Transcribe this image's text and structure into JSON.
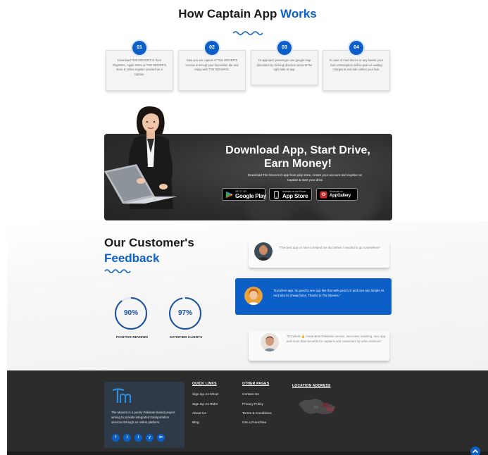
{
  "how_it_works": {
    "title_main": "How Captain App",
    "title_accent": "Works",
    "steps": [
      {
        "num": "01",
        "text": "Download THE MOVER'S D from PlayStore, Apple Store or THE MOVER'S store & online register yourself as a captain."
      },
      {
        "num": "02",
        "text": "Now you are captain of THE MOVER'S receive & accept your favorable ride and enjoy with THE MOVER'S."
      },
      {
        "num": "03",
        "text": "To approach passenger use google map directions by clicking direction arrow at the right side of app."
      },
      {
        "num": "04",
        "text": "In case of road blocks or any hassle your fuel consumption will be paid as waiting charges & end ride collect your fare."
      }
    ]
  },
  "banner": {
    "title": "Download App, Start Drive, Earn Money!",
    "subtitle": "Download The Movers D app from paly store, create your account and register as Captain & start your drive",
    "google_play": {
      "small": "GET IT ON",
      "big": "Google Play"
    },
    "app_store": {
      "small": "Available on the iPhone",
      "big": "App Store"
    },
    "app_gallery": {
      "small": "Download on",
      "big": "AppGallery"
    }
  },
  "feedback": {
    "title_main": "Our Customer's",
    "title_accent": "Feedback",
    "stats": [
      {
        "value": "90%",
        "fraction": 0.9,
        "label": "POSITIVE REVIEWS"
      },
      {
        "value": "97%",
        "fraction": 0.97,
        "label": "SATISFIED CLIENTS"
      }
    ],
    "reviews": [
      {
        "text": "\"The best app on here it helped me alot When I needed to go somewhere\""
      },
      {
        "text": "\"Excellent app. Its good to see app like that with good UX and nice and simple UI. And also its cheap fares. Thanks to The Movers.\""
      },
      {
        "text": "\"Excellent 👍 Great Best Pakistani service, executive traveling, nice app, and more than benefits for captains and customers by other services\""
      }
    ]
  },
  "footer": {
    "about": "The Movers is a purely Pakistan-based project aiming to provide integrated transportation services through an online platform.",
    "socials": [
      "f",
      "t",
      "i",
      "y",
      "in"
    ],
    "quick_links_title": "QUICK LINKS",
    "quick_links": [
      "Sign Up As Driver",
      "Sign Up As Rider",
      "About Us",
      "Blog"
    ],
    "other_pages_title": "OTHER PAGES",
    "other_pages": [
      "Contact Us",
      "Privacy Policy",
      "Terms & Conditions",
      "Get a Franchise"
    ],
    "location_title": "LOCATION ADDRESS"
  },
  "colors": {
    "accent": "#0b5fc7",
    "footer": "#2c2c2c",
    "card": "#2f3a48"
  }
}
